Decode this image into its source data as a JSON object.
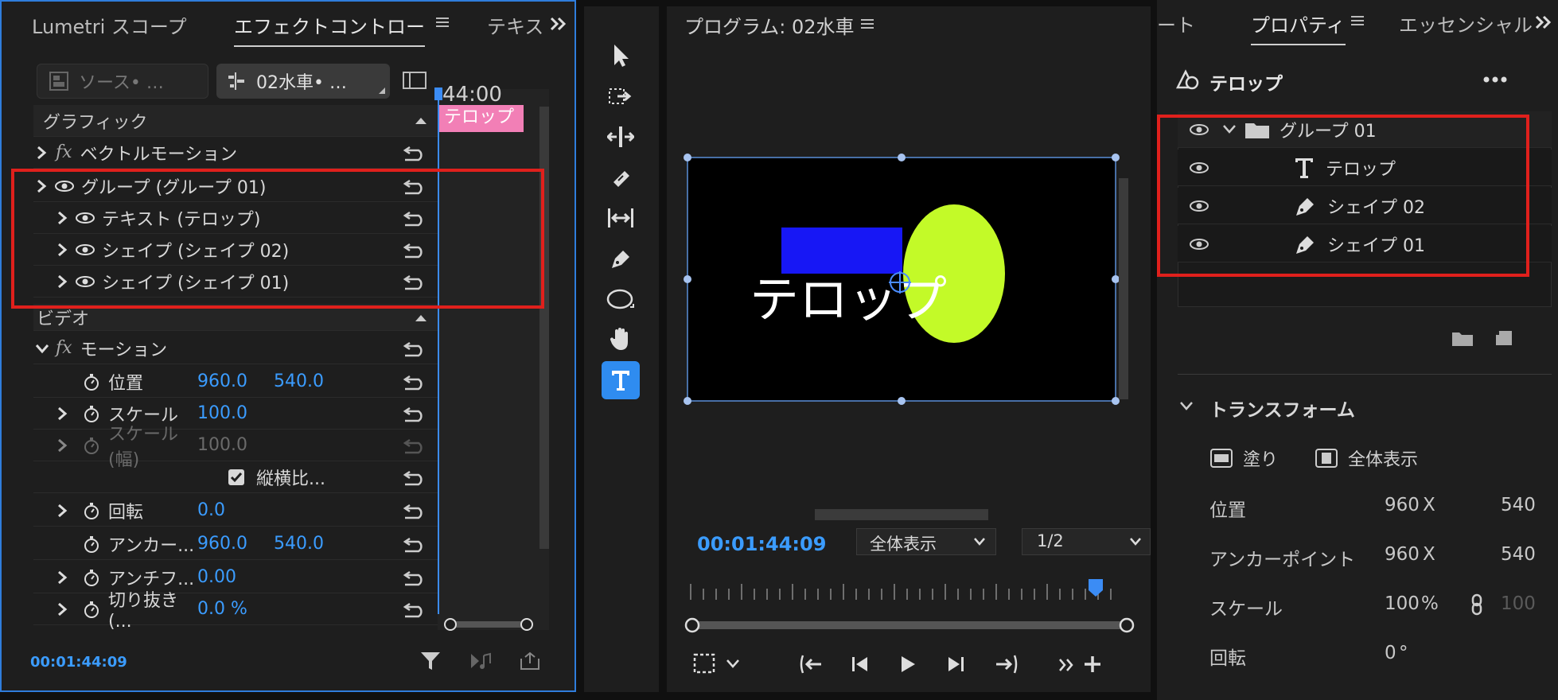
{
  "effect_controls": {
    "tabs": [
      "Lumetri スコープ",
      "エフェクトコントロー",
      "テキス"
    ],
    "source_label": "ソース• …",
    "sequence_label": "02水車• …",
    "timeline_time": "44:00",
    "clip_label": "テロップ",
    "sections": {
      "graphic": "グラフィック",
      "video": "ビデオ"
    },
    "rows": {
      "vector_motion": "ベクトルモーション",
      "group": "グループ (グループ 01)",
      "text": "テキスト (テロップ)",
      "shape2": "シェイプ (シェイプ 02)",
      "shape1": "シェイプ (シェイプ 01)",
      "motion": "モーション",
      "position_label": "位置",
      "position_x": "960.0",
      "position_y": "540.0",
      "scale_label": "スケール",
      "scale_value": "100.0",
      "scale_w_label": "スケール (幅)",
      "scale_w_value": "100.0",
      "uniform_label": "縦横比...",
      "rotation_label": "回転",
      "rotation_value": "0.0",
      "anchor_label": "アンカー...",
      "anchor_x": "960.0",
      "anchor_y": "540.0",
      "antiflicker_label": "アンチフ...",
      "antiflicker_value": "0.00",
      "crop_label": "切り抜き (...",
      "crop_value": "0.0 %"
    },
    "timecode": "00:01:44:09"
  },
  "program": {
    "title": "プログラム: 02水車",
    "telop_text": "テロップ",
    "timecode": "00:01:44:09",
    "fit_label": "全体表示",
    "resolution_label": "1/2",
    "colors": {
      "rect": "#1717f5",
      "ellipse": "#c3fa28"
    }
  },
  "properties": {
    "tabs": [
      "ート",
      "プロパティ",
      "エッセンシャル"
    ],
    "title": "テロップ",
    "layers": {
      "group": "グループ 01",
      "telop": "テロップ",
      "shape2": "シェイプ 02",
      "shape1": "シェイプ 01"
    },
    "transform_title": "トランスフォーム",
    "fill_label": "塗り",
    "fit_label": "全体表示",
    "position_label": "位置",
    "position_x": "960",
    "position_y": "540",
    "anchor_label": "アンカーポイント",
    "anchor_x": "960",
    "anchor_y": "540",
    "scale_label": "スケール",
    "scale_value": "100",
    "scale_unit": "%",
    "scale_second": "100",
    "rotation_label": "回転",
    "rotation_value": "0",
    "rotation_unit": "°",
    "x_label": "X"
  }
}
